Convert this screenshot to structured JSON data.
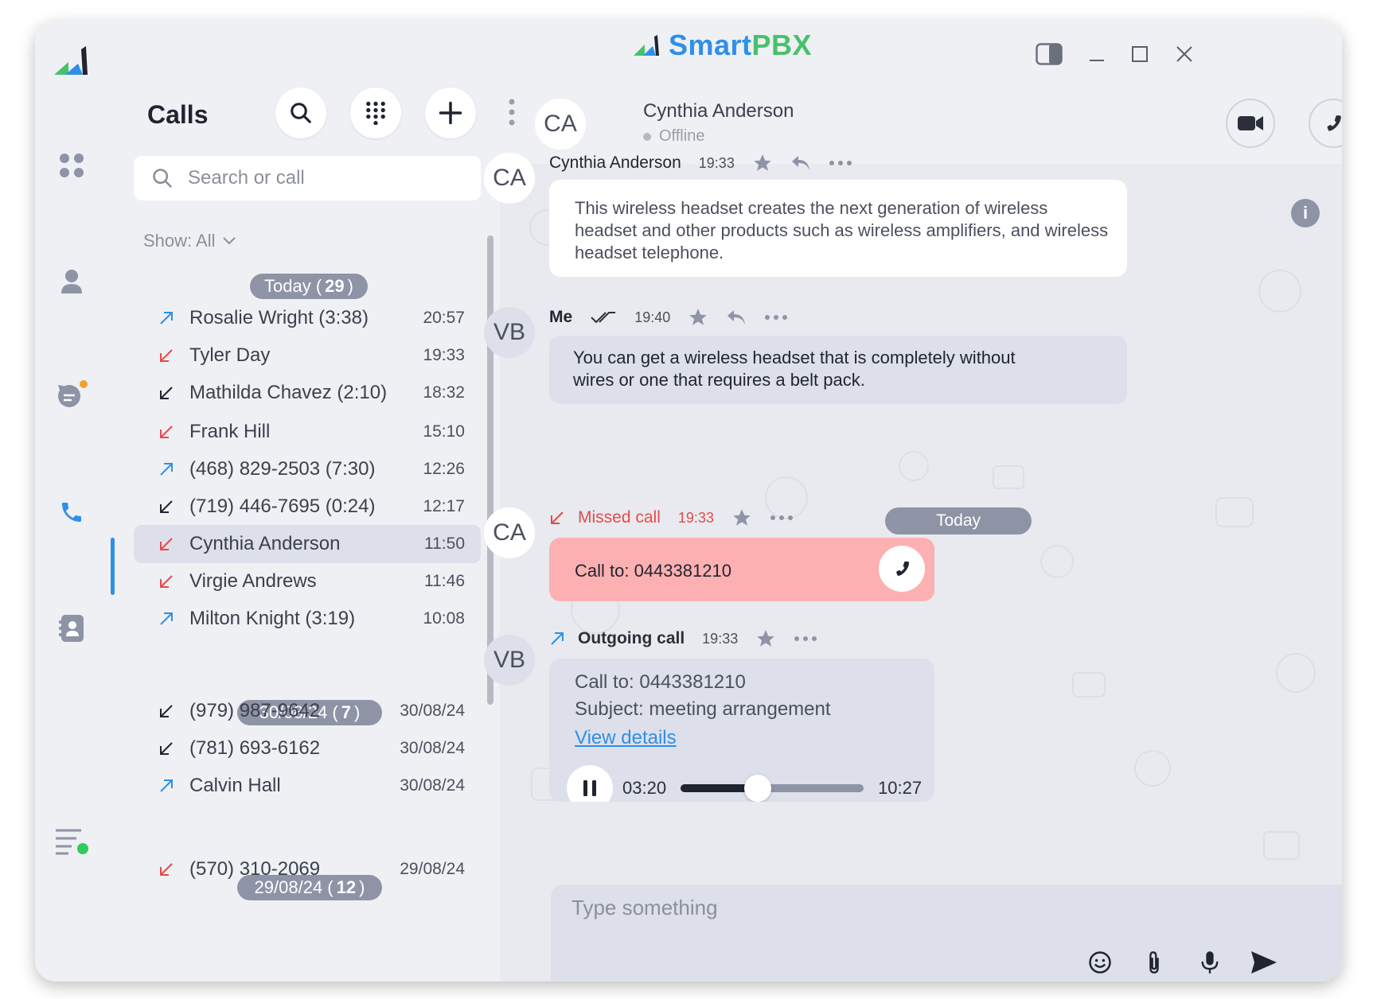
{
  "app": {
    "brand_prefix": "Smart",
    "brand_suffix": "PBX",
    "colors": {
      "accent": "#2f8fe8",
      "brand_green": "#47c26a",
      "missed": "#e84a4a",
      "outgoing": "#2f8fe8"
    }
  },
  "calls": {
    "title": "Calls",
    "search_placeholder": "Search or call",
    "show_filter": "Show: All",
    "groups": [
      {
        "label": "Today (",
        "count": "29",
        "close": ")"
      },
      {
        "label": "30/08/24 (",
        "count": "7",
        "close": ")"
      },
      {
        "label": "29/08/24 (",
        "count": "12",
        "close": ")"
      }
    ],
    "rows": [
      {
        "name": "Rosalie Wright (3:38)",
        "time": "20:57",
        "dir": "outgoing"
      },
      {
        "name": "Tyler Day",
        "time": "19:33",
        "dir": "missed"
      },
      {
        "name": "Mathilda Chavez (2:10)",
        "time": "18:32",
        "dir": "incoming"
      },
      {
        "name": "Frank Hill",
        "time": "15:10",
        "dir": "missed"
      },
      {
        "name": "(468) 829-2503 (7:30)",
        "time": "12:26",
        "dir": "outgoing"
      },
      {
        "name": "(719) 446-7695 (0:24)",
        "time": "12:17",
        "dir": "incoming"
      },
      {
        "name": "Cynthia Anderson",
        "time": "11:50",
        "dir": "missed"
      },
      {
        "name": "Virgie Andrews",
        "time": "11:46",
        "dir": "missed"
      },
      {
        "name": "Milton Knight (3:19)",
        "time": "10:08",
        "dir": "outgoing"
      },
      {
        "name": "(979) 987-9642",
        "time": "30/08/24",
        "dir": "incoming"
      },
      {
        "name": "(781) 693-6162",
        "time": "30/08/24",
        "dir": "incoming"
      },
      {
        "name": "Calvin Hall",
        "time": "30/08/24",
        "dir": "outgoing"
      },
      {
        "name": "(570) 310-2069",
        "time": "29/08/24",
        "dir": "missed"
      }
    ]
  },
  "chat": {
    "contact_initials": "CA",
    "contact_name": "Cynthia Anderson",
    "contact_status": "Offline",
    "me_initials": "VB",
    "messages": [
      {
        "who": "Cynthia Anderson",
        "time": "19:33",
        "text": "This wireless headset creates the next generation of wireless headset and other products such as wireless amplifiers, and wireless headset telephone."
      },
      {
        "who": "Me",
        "time": "19:40",
        "text": "You can get a wireless headset that is completely without wires or one that requires a belt pack."
      }
    ],
    "day_divider": "Today",
    "missed_call": {
      "label": "Missed call",
      "time": "19:33",
      "text": "Call to: 0443381210"
    },
    "outgoing_call": {
      "label": "Outgoing call",
      "time": "19:33",
      "call_to": "Call to: 0443381210",
      "subject": "Subject: meeting arrangement",
      "link": "View details",
      "elapsed": "03:20",
      "duration": "10:27",
      "progress": 0.42
    },
    "composer_placeholder": "Type something"
  }
}
